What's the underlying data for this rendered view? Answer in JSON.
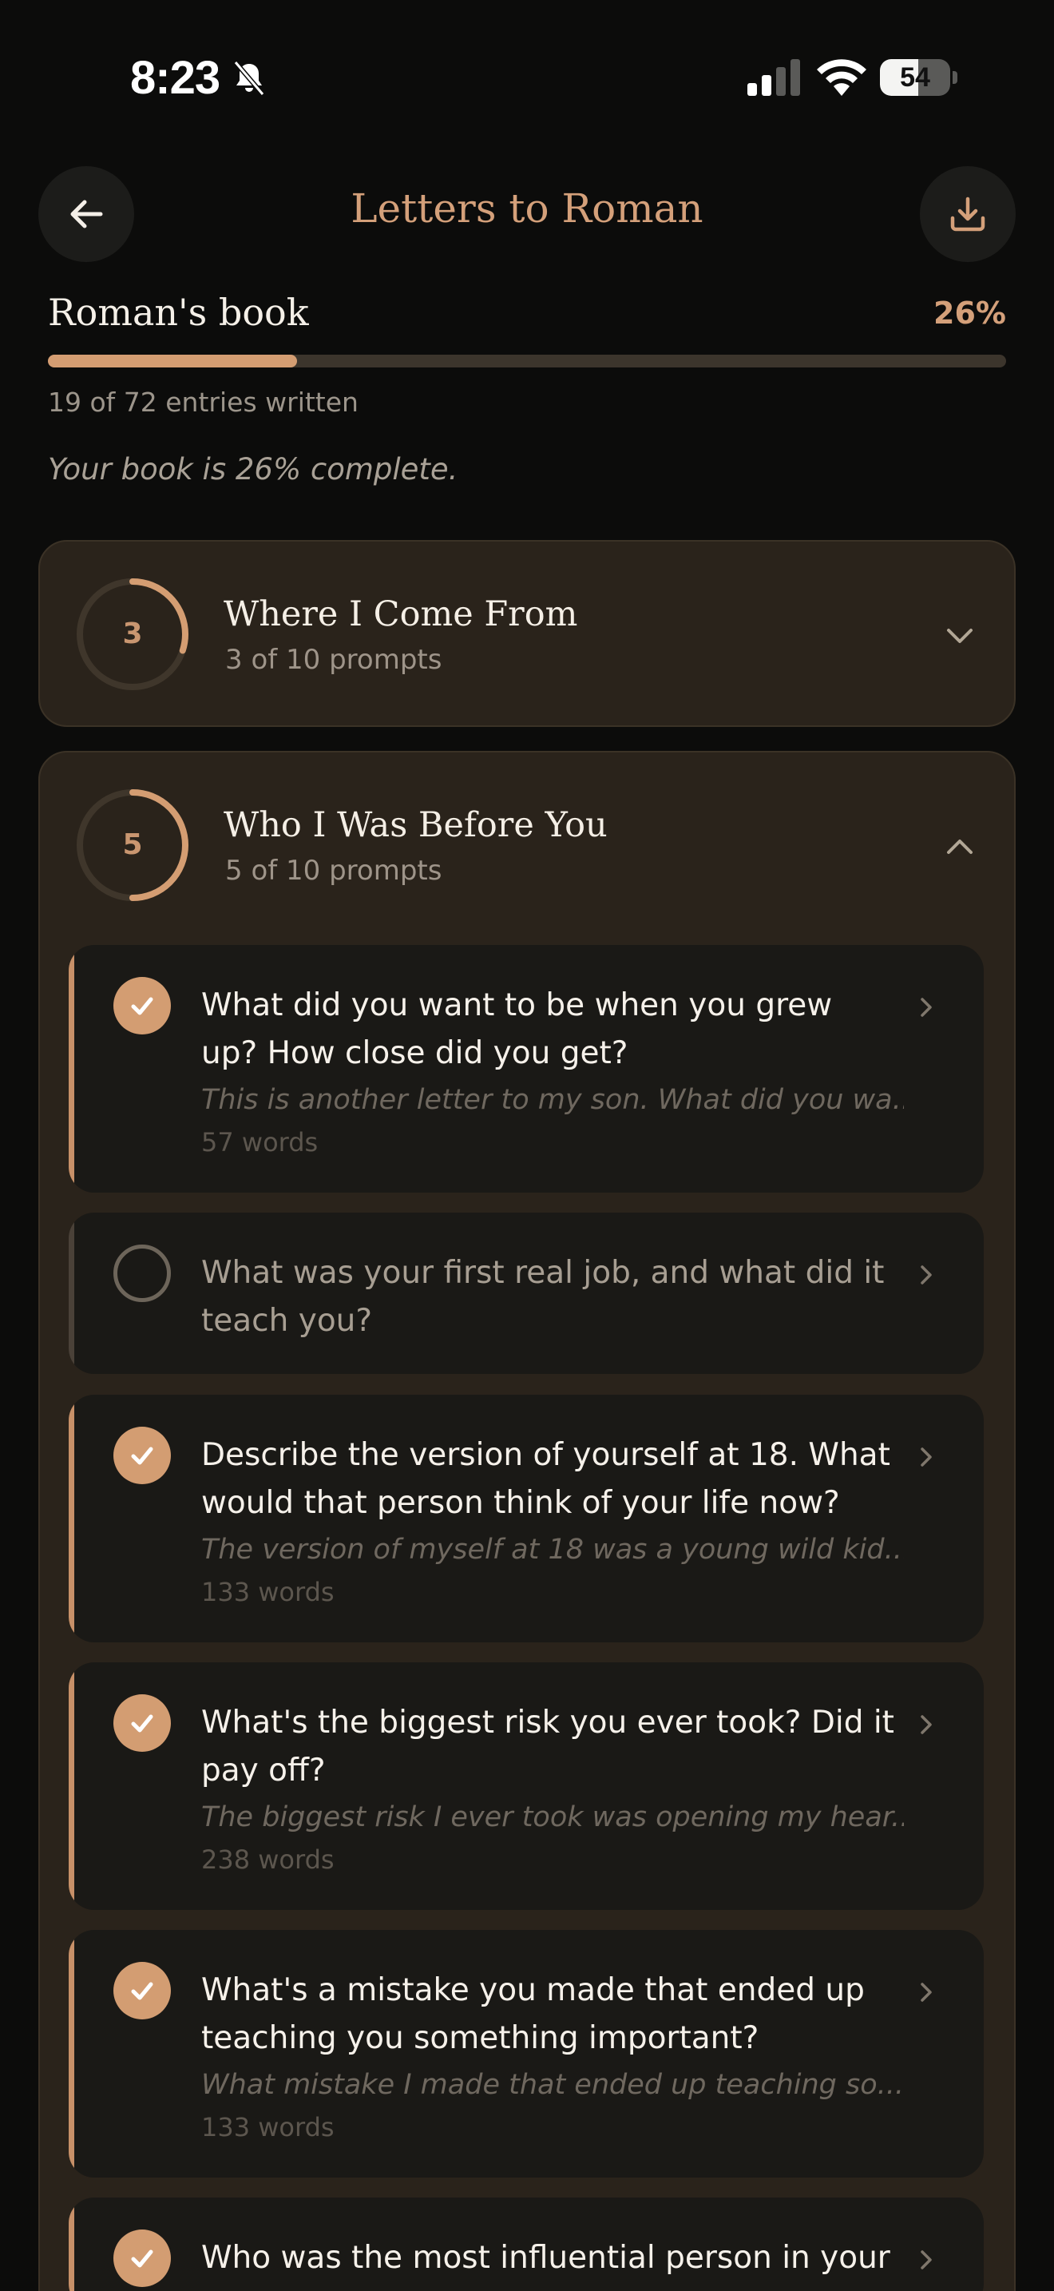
{
  "status_bar": {
    "time": "8:23",
    "battery": "54",
    "battery_level": 0.54
  },
  "header": {
    "title": "Letters to Roman",
    "back_icon": "arrow-left-icon",
    "download_icon": "download-icon"
  },
  "progress": {
    "book_name": "Roman's book",
    "percent_label": "26%",
    "percent": 26,
    "entries_text": "19 of 72 entries written",
    "complete_text": "Your book is 26% complete."
  },
  "sections": [
    {
      "count": "3",
      "title": "Where I Come From",
      "subtitle": "3 of 10 prompts",
      "fraction": 0.3,
      "expanded": false
    },
    {
      "count": "5",
      "title": "Who I Was Before You",
      "subtitle": "5 of 10 prompts",
      "fraction": 0.5,
      "expanded": true
    }
  ],
  "prompts": [
    {
      "question": "What did you want to be when you grew up? How close did you get?",
      "excerpt": "This is another letter to my son. What did you wa...",
      "words": "57 words",
      "done": true
    },
    {
      "question": "What was your first real job, and what did it teach you?",
      "excerpt": "",
      "words": "",
      "done": false
    },
    {
      "question": "Describe the version of yourself at 18. What would that person think of your life now?",
      "excerpt": "The version of myself at 18 was a young wild kid...",
      "words": "133 words",
      "done": true
    },
    {
      "question": "What's the biggest risk you ever took? Did it pay off?",
      "excerpt": "The biggest risk I ever took was opening my hear...",
      "words": "238 words",
      "done": true
    },
    {
      "question": "What's a mistake you made that ended up teaching you something important?",
      "excerpt": "What mistake I made that ended up teaching so...",
      "words": "133 words",
      "done": true
    },
    {
      "question": "Who was the most influential person in your",
      "excerpt": "",
      "words": "",
      "done": true
    }
  ],
  "colors": {
    "accent": "#d49d72",
    "card": "#1a1916",
    "section": "#2a231b",
    "background": "#0c0c0b"
  }
}
